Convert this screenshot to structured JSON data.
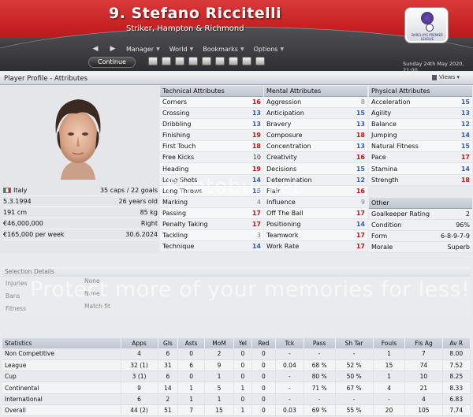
{
  "header": {
    "title": "9. Stefano Riccitelli",
    "subtitle": "Striker, Hampton & Richmond",
    "badge_text": "BARCLAYS PREMIER LEAGUE"
  },
  "nav": {
    "back": "◀",
    "forward": "▶",
    "menus": [
      "Manager",
      "World",
      "Bookmarks",
      "Options"
    ]
  },
  "continue_label": "Continue",
  "toolbar_icons": [
    "home-icon",
    "inbox-icon",
    "calendar-icon",
    "squad-icon",
    "tactics-icon",
    "training-icon",
    "finances-icon",
    "club-icon",
    "world-icon"
  ],
  "date": "Sunday 24th May 2020, 21:00",
  "panel": {
    "title": "Player Profile - Attributes",
    "views_label": "Views"
  },
  "profile": {
    "nation": "Italy",
    "caps": "35 caps / 22 goals",
    "dob": "5.3.1994",
    "age": "26 years old",
    "height": "191 cm",
    "weight": "85 kg",
    "value": "€46,000,000",
    "foot": "Right",
    "wage": "€165,000 per week",
    "contract": "30.6.2024"
  },
  "technical": {
    "title": "Technical Attributes",
    "rows": [
      {
        "name": "Corners",
        "value": "16",
        "color": "red"
      },
      {
        "name": "Crossing",
        "value": "13",
        "color": "blue"
      },
      {
        "name": "Dribbling",
        "value": "13",
        "color": "blue"
      },
      {
        "name": "Finishing",
        "value": "19",
        "color": "red"
      },
      {
        "name": "First Touch",
        "value": "18",
        "color": "red"
      },
      {
        "name": "Free Kicks",
        "value": "10",
        "color": "dark"
      },
      {
        "name": "Heading",
        "value": "19",
        "color": "red"
      },
      {
        "name": "Long Shots",
        "value": "14",
        "color": "blue"
      },
      {
        "name": "Long Throws",
        "value": "15",
        "color": "blue"
      },
      {
        "name": "Marking",
        "value": "4",
        "color": "grey"
      },
      {
        "name": "Passing",
        "value": "17",
        "color": "red"
      },
      {
        "name": "Penalty Taking",
        "value": "17",
        "color": "red"
      },
      {
        "name": "Tackling",
        "value": "3",
        "color": "grey"
      },
      {
        "name": "Technique",
        "value": "14",
        "color": "blue"
      }
    ]
  },
  "mental": {
    "title": "Mental Attributes",
    "rows": [
      {
        "name": "Aggression",
        "value": "8",
        "color": "grey"
      },
      {
        "name": "Anticipation",
        "value": "15",
        "color": "blue"
      },
      {
        "name": "Bravery",
        "value": "13",
        "color": "blue"
      },
      {
        "name": "Composure",
        "value": "18",
        "color": "red"
      },
      {
        "name": "Concentration",
        "value": "13",
        "color": "blue"
      },
      {
        "name": "Creativity",
        "value": "16",
        "color": "red"
      },
      {
        "name": "Decisions",
        "value": "15",
        "color": "blue"
      },
      {
        "name": "Determination",
        "value": "12",
        "color": "blue"
      },
      {
        "name": "Flair",
        "value": "16",
        "color": "red"
      },
      {
        "name": "Influence",
        "value": "9",
        "color": "grey"
      },
      {
        "name": "Off The Ball",
        "value": "17",
        "color": "red"
      },
      {
        "name": "Positioning",
        "value": "14",
        "color": "blue"
      },
      {
        "name": "Teamwork",
        "value": "17",
        "color": "red"
      },
      {
        "name": "Work Rate",
        "value": "17",
        "color": "red"
      }
    ]
  },
  "physical": {
    "title": "Physical Attributes",
    "rows": [
      {
        "name": "Acceleration",
        "value": "15",
        "color": "blue"
      },
      {
        "name": "Agility",
        "value": "13",
        "color": "blue"
      },
      {
        "name": "Balance",
        "value": "12",
        "color": "blue"
      },
      {
        "name": "Jumping",
        "value": "14",
        "color": "blue"
      },
      {
        "name": "Natural Fitness",
        "value": "15",
        "color": "blue"
      },
      {
        "name": "Pace",
        "value": "17",
        "color": "red"
      },
      {
        "name": "Stamina",
        "value": "14",
        "color": "blue"
      },
      {
        "name": "Strength",
        "value": "18",
        "color": "red"
      }
    ]
  },
  "other": {
    "title": "Other",
    "rows": [
      {
        "name": "Goalkeeper Rating",
        "value": "2"
      },
      {
        "name": "Condition",
        "value": "96%"
      },
      {
        "name": "Form",
        "value": "6-8-9-7-9"
      },
      {
        "name": "Morale",
        "value": "Superb"
      }
    ]
  },
  "selection": {
    "title": "Selection Details",
    "rows": [
      {
        "label": "Injuries",
        "value": "None"
      },
      {
        "label": "Bans",
        "value": "None"
      },
      {
        "label": "Fitness",
        "value": "Match fit"
      }
    ]
  },
  "stats": {
    "headers": [
      "Statistics",
      "Apps",
      "Gls",
      "Asts",
      "MoM",
      "Yel",
      "Red",
      "Tck",
      "Pass",
      "Sh Tar",
      "Fouls",
      "Fls Ag",
      "Av R"
    ],
    "rows": [
      [
        "Non Competitive",
        "4",
        "6",
        "0",
        "2",
        "0",
        "0",
        "-",
        "-",
        "-",
        "1",
        "7",
        "8.00"
      ],
      [
        "League",
        "32 (1)",
        "31",
        "6",
        "9",
        "0",
        "0",
        "0.04",
        "68 %",
        "52 %",
        "15",
        "74",
        "7.52"
      ],
      [
        "Cup",
        "3 (1)",
        "6",
        "0",
        "1",
        "0",
        "0",
        "-",
        "80 %",
        "50 %",
        "1",
        "10",
        "8.25"
      ],
      [
        "Continental",
        "9",
        "14",
        "1",
        "5",
        "1",
        "0",
        "-",
        "71 %",
        "67 %",
        "4",
        "21",
        "8.33"
      ],
      [
        "International",
        "6",
        "2",
        "1",
        "1",
        "0",
        "0",
        "-",
        "-",
        "-",
        "-",
        "4",
        "6.83"
      ],
      [
        "Overall",
        "44 (2)",
        "51",
        "7",
        "15",
        "1",
        "0",
        "0.03",
        "69 %",
        "55 %",
        "20",
        "105",
        "7.74"
      ]
    ]
  },
  "watermark": {
    "line1": "Photobucket",
    "line2": "Protect more of your memories for less!"
  }
}
